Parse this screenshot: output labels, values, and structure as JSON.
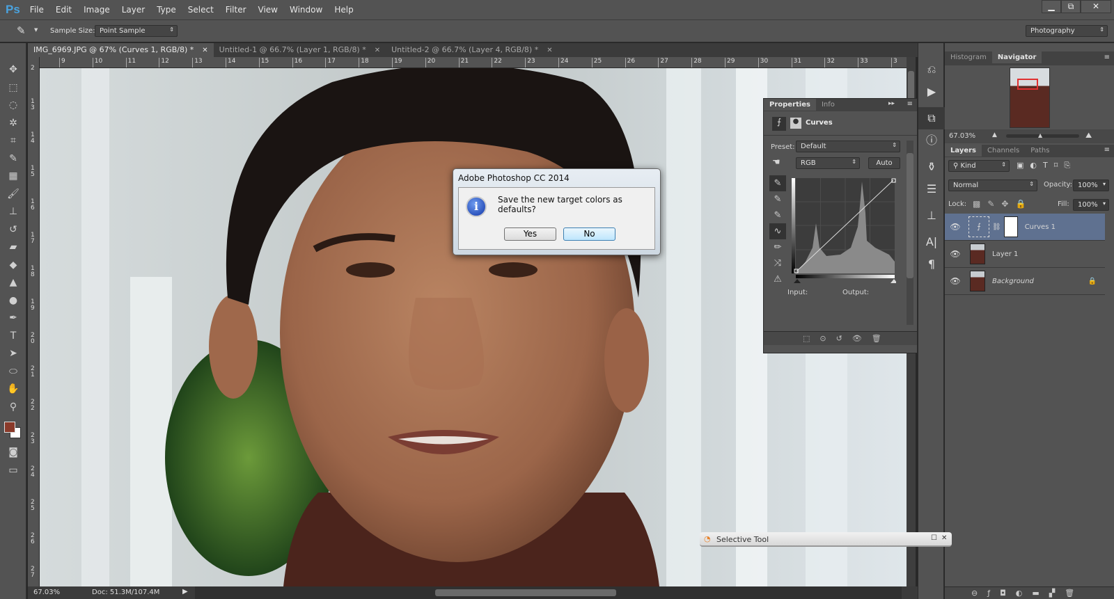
{
  "app": {
    "logo": "Ps",
    "menu": [
      "File",
      "Edit",
      "Image",
      "Layer",
      "Type",
      "Select",
      "Filter",
      "View",
      "Window",
      "Help"
    ],
    "window_controls": {
      "minimize": "▁",
      "restore": "⧉",
      "close": "✕"
    }
  },
  "options": {
    "sample_size_label": "Sample Size:",
    "sample_size_value": "Point Sample",
    "workspace": "Photography"
  },
  "tabs": [
    {
      "label": "IMG_6969.JPG @ 67% (Curves 1, RGB/8) *",
      "active": true
    },
    {
      "label": "Untitled-1 @ 66.7% (Layer 1, RGB/8) *",
      "active": false
    },
    {
      "label": "Untitled-2 @ 66.7% (Layer 4, RGB/8) *",
      "active": false
    }
  ],
  "ruler": {
    "h": [
      "9",
      "10",
      "11",
      "12",
      "13",
      "14",
      "15",
      "16",
      "17",
      "18",
      "19",
      "20",
      "21",
      "22",
      "23",
      "24",
      "25",
      "26",
      "27",
      "28",
      "29",
      "30",
      "31",
      "32",
      "33",
      "3"
    ],
    "v": [
      "2",
      "13",
      "14",
      "15",
      "16",
      "17",
      "18",
      "19",
      "20",
      "21",
      "22",
      "23",
      "24",
      "25",
      "26",
      "27"
    ]
  },
  "status": {
    "zoom": "67.03%",
    "doc": "Doc: 51.3M/107.4M"
  },
  "navigator": {
    "tabs": [
      "Histogram",
      "Navigator"
    ],
    "zoom": "67.03%"
  },
  "layers_panel": {
    "tabs": [
      "Layers",
      "Channels",
      "Paths"
    ],
    "filter": "Kind",
    "blend_mode": "Normal",
    "opacity_label": "Opacity:",
    "opacity": "100%",
    "lock_label": "Lock:",
    "fill_label": "Fill:",
    "fill": "100%",
    "layers": [
      {
        "name": "Curves 1",
        "selected": true
      },
      {
        "name": "Layer 1",
        "selected": false
      },
      {
        "name": "Background",
        "selected": false,
        "locked": true
      }
    ]
  },
  "properties": {
    "tabs": [
      "Properties",
      "Info"
    ],
    "title": "Curves",
    "preset_label": "Preset:",
    "preset": "Default",
    "channel": "RGB",
    "auto": "Auto",
    "input_label": "Input:",
    "output_label": "Output:"
  },
  "dialog": {
    "title": "Adobe Photoshop CC 2014",
    "message": "Save the new target colors as defaults?",
    "yes": "Yes",
    "no": "No"
  },
  "selective_tool": {
    "title": "Selective Tool"
  },
  "colors": {
    "foreground": "#8a3a2a",
    "background": "#ffffff",
    "selected_layer": "#5f7190",
    "accent": "#4aa3df"
  }
}
